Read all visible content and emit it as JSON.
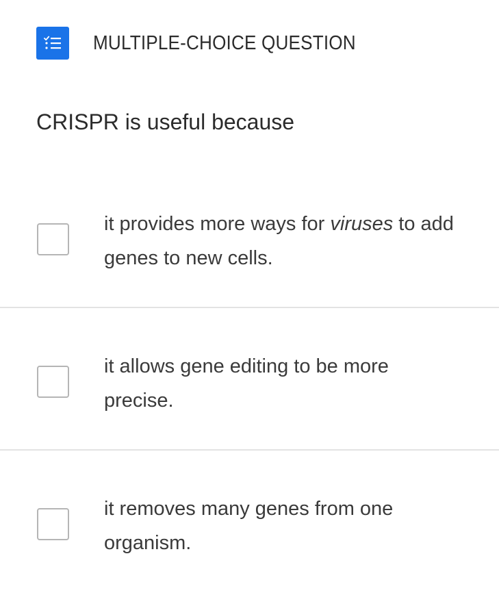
{
  "header": {
    "icon": "checklist-icon",
    "accent_color": "#1a73e8",
    "type_label": "MULTIPLE-CHOICE QUESTION"
  },
  "question": {
    "text": "CRISPR is useful because"
  },
  "options": [
    {
      "text_before": "it provides more ways for ",
      "text_emphasis": "viruses",
      "text_after": " to add genes to new cells.",
      "checked": false
    },
    {
      "text": "it allows gene editing to be more precise.",
      "checked": false
    },
    {
      "text": "it removes many genes from one organism.",
      "checked": false
    }
  ]
}
